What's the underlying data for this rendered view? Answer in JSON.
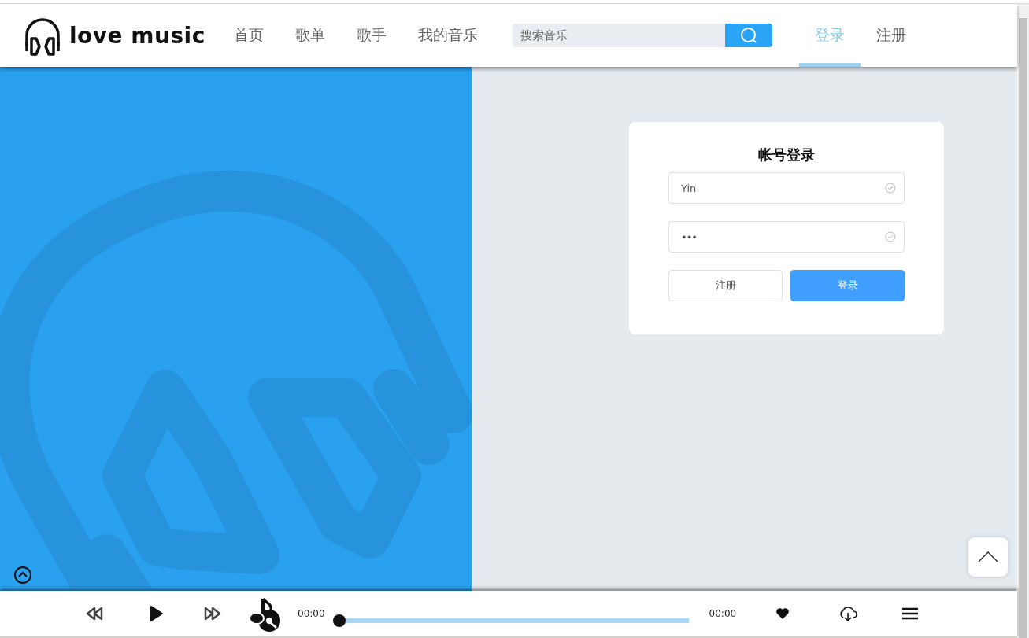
{
  "header": {
    "logo_text": "love music",
    "nav": [
      {
        "label": "首页",
        "selected": false
      },
      {
        "label": "歌单",
        "selected": false
      },
      {
        "label": "歌手",
        "selected": false
      },
      {
        "label": "我的音乐",
        "selected": false
      }
    ],
    "search": {
      "placeholder": "搜索音乐"
    },
    "account_links": [
      {
        "label": "登录",
        "selected": true
      },
      {
        "label": "注册",
        "selected": false
      }
    ]
  },
  "login": {
    "title": "帐号登录",
    "fields": [
      {
        "kind": "text",
        "value": "Yin",
        "valid": true
      },
      {
        "kind": "password",
        "value": "•••",
        "valid": true
      }
    ],
    "buttons": [
      {
        "label": "注册",
        "primary": false
      },
      {
        "label": "登录",
        "primary": true
      }
    ]
  },
  "player": {
    "current_time": "00:00",
    "total_time": "00:00",
    "level": 0,
    "liked": true
  }
}
